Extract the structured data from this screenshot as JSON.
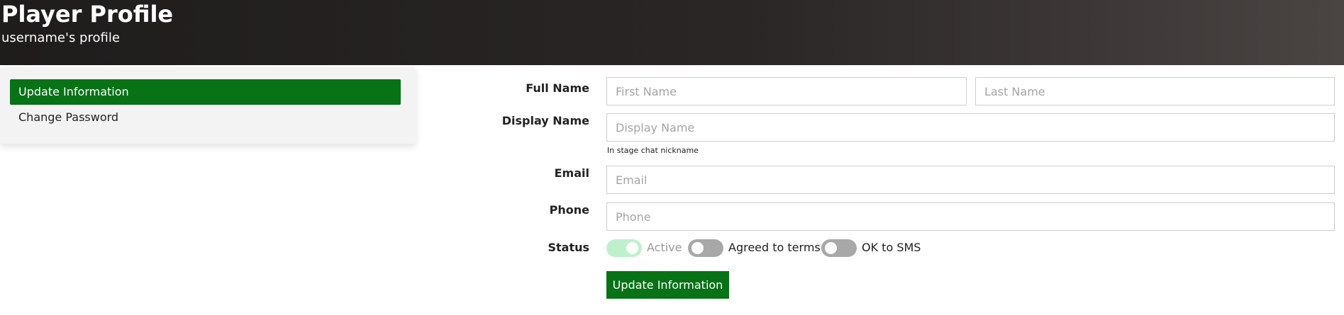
{
  "header": {
    "title": "Player Profile",
    "subtitle": "username's profile"
  },
  "sidebar": {
    "items": [
      {
        "label": "Update Information",
        "active": true
      },
      {
        "label": "Change Password",
        "active": false
      }
    ]
  },
  "form": {
    "full_name": {
      "label": "Full Name",
      "first_placeholder": "First Name",
      "last_placeholder": "Last Name",
      "first_value": "",
      "last_value": ""
    },
    "display_name": {
      "label": "Display Name",
      "placeholder": "Display Name",
      "value": "",
      "hint": "In stage chat nickname"
    },
    "email": {
      "label": "Email",
      "placeholder": "Email",
      "value": ""
    },
    "phone": {
      "label": "Phone",
      "placeholder": "Phone",
      "value": ""
    },
    "status": {
      "label": "Status",
      "toggles": [
        {
          "label": "Active",
          "on": true,
          "disabled": true
        },
        {
          "label": "Agreed to terms",
          "on": false,
          "disabled": false
        },
        {
          "label": "OK to SMS",
          "on": false,
          "disabled": false
        }
      ]
    },
    "submit_label": "Update Information"
  },
  "colors": {
    "accent": "#077216",
    "toggle_on": "#bff0cc",
    "toggle_off": "#a8a8a8",
    "header_dark": "#1f1c1c"
  }
}
